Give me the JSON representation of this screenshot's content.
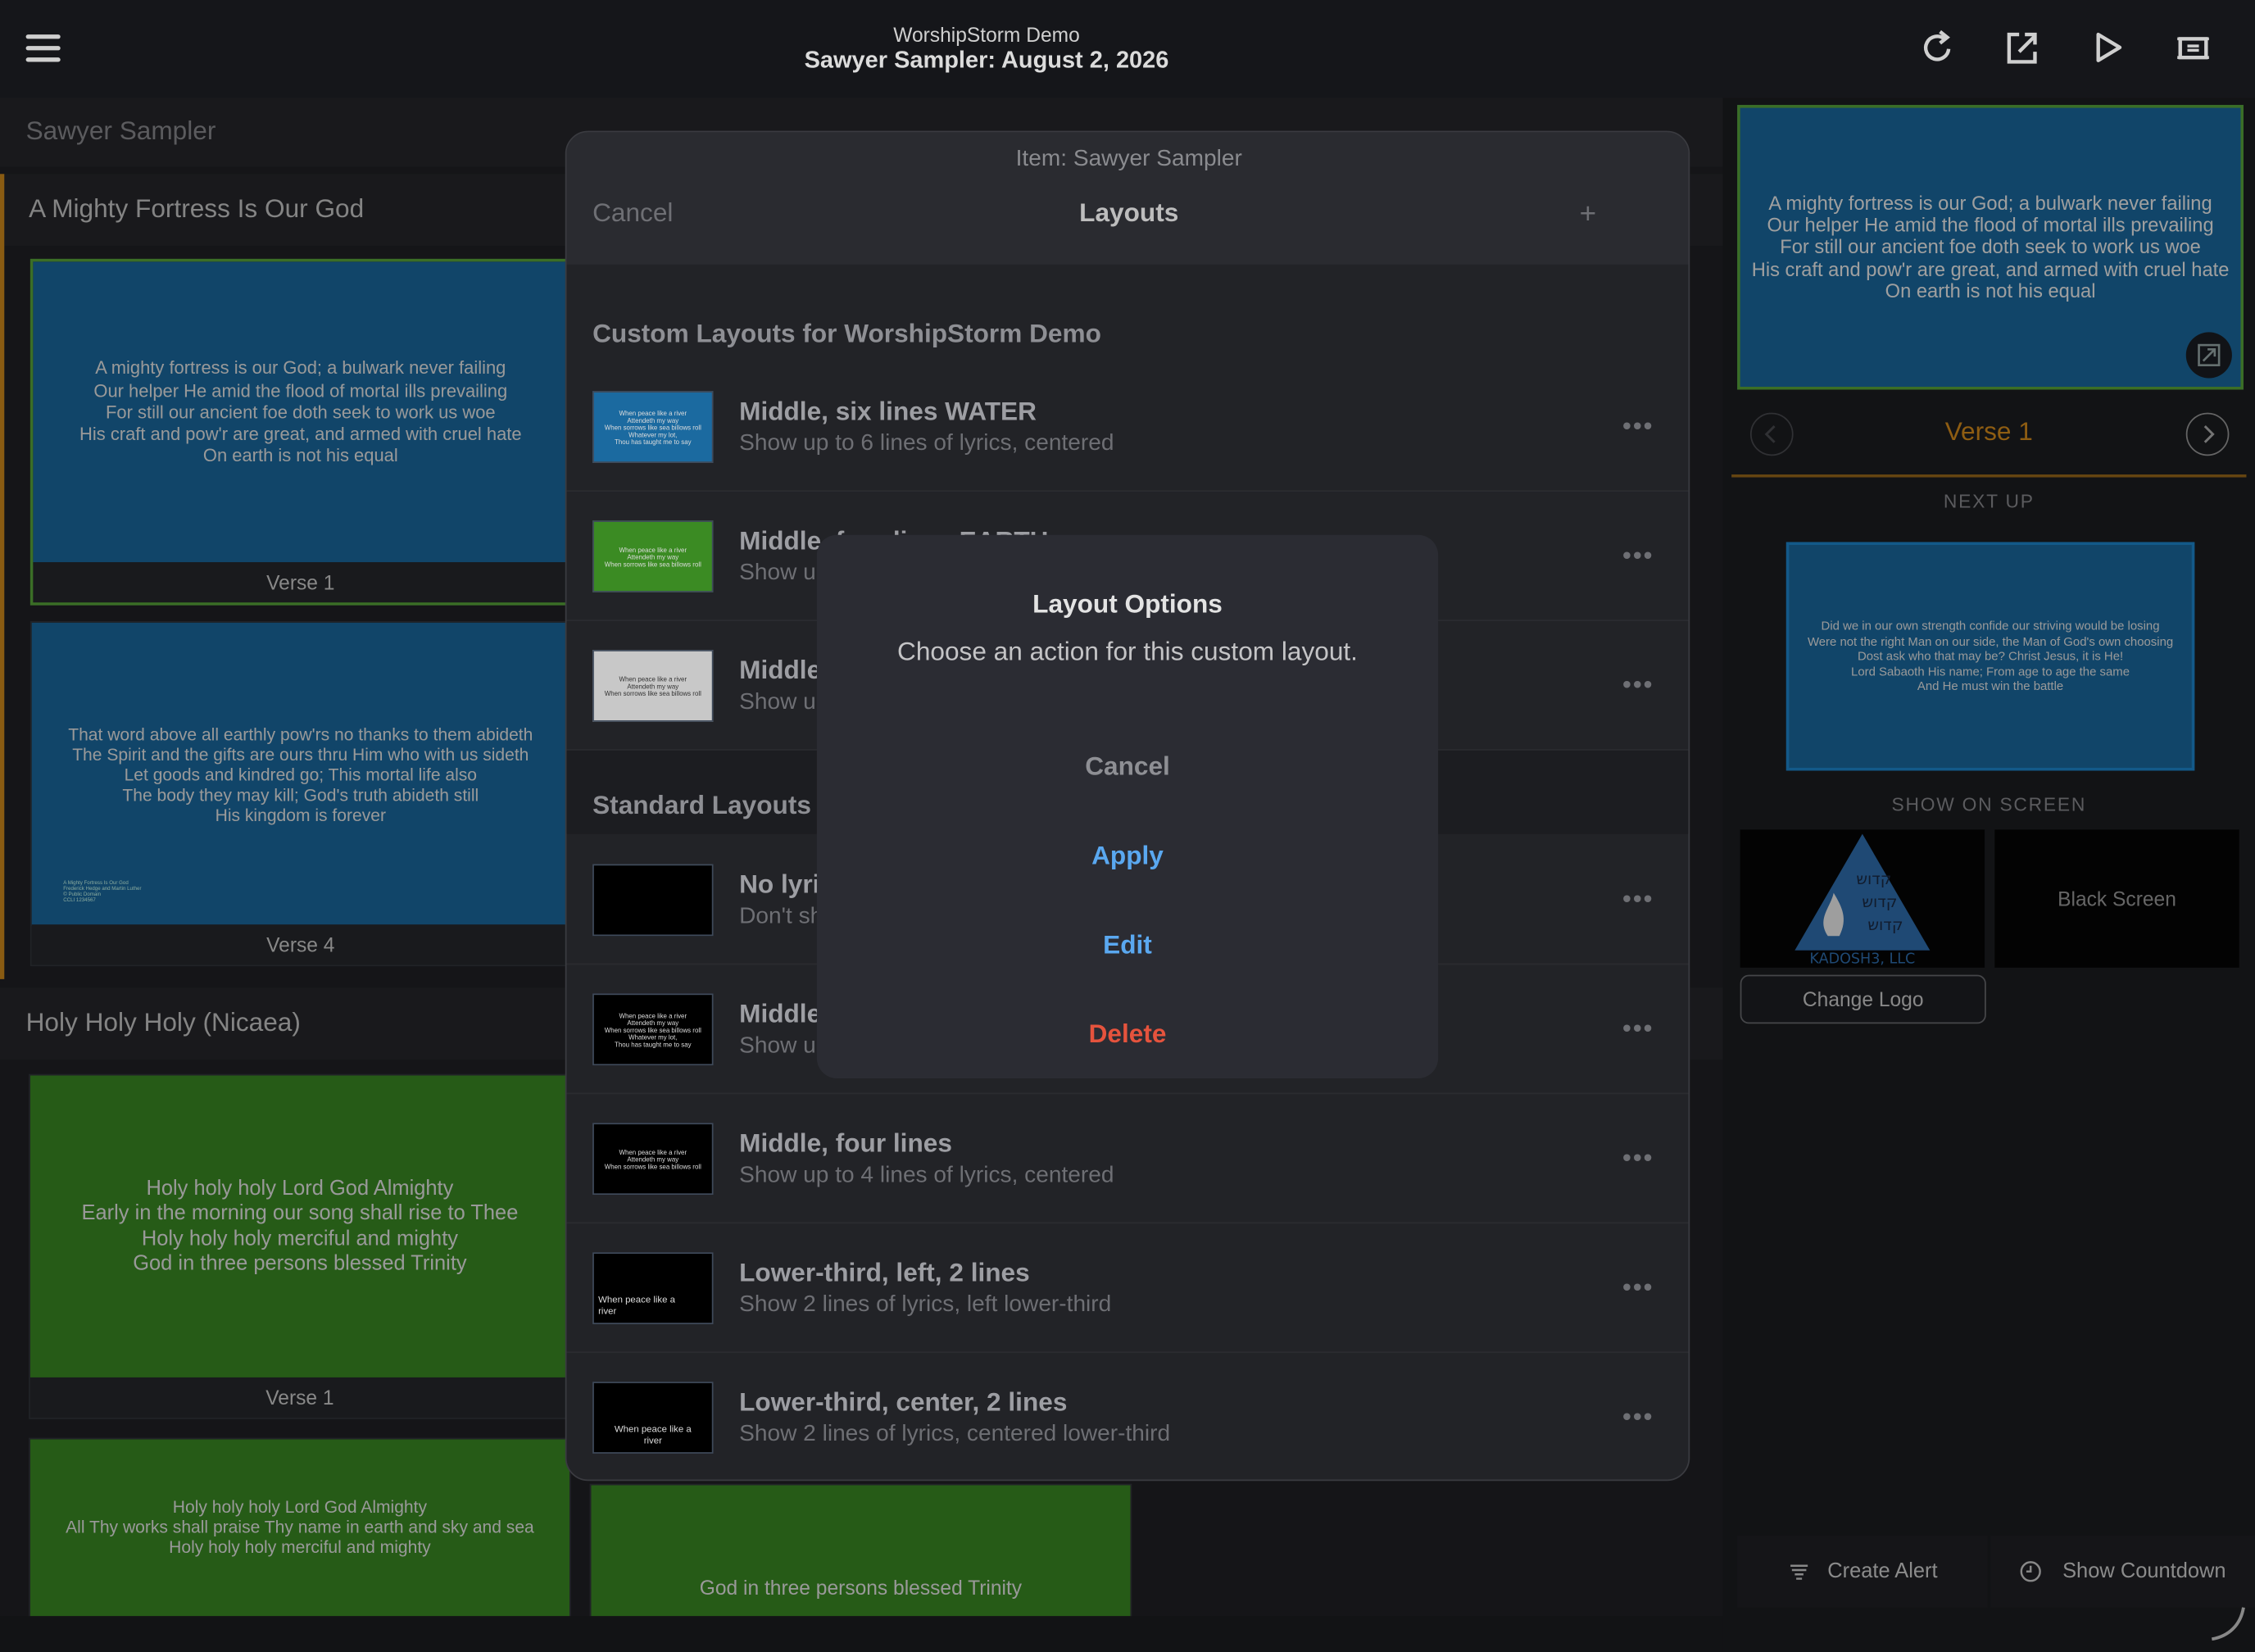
{
  "topbar": {
    "app_title": "WorshipStorm Demo",
    "service_title": "Sawyer Sampler: August 2, 2026",
    "icons": [
      "menu-icon",
      "refresh-icon",
      "export-icon",
      "play-icon",
      "screen-icon"
    ]
  },
  "list": {
    "header": "Sawyer Sampler",
    "songs": [
      {
        "title": "A Mighty Fortress Is Our God",
        "slides": [
          {
            "caption": "Verse 1",
            "lyrics": [
              "A mighty fortress is our God; a bulwark never failing",
              "Our helper He amid the flood of mortal ills prevailing",
              "For still our ancient foe doth seek to work us woe",
              "His craft and pow'r are great, and armed with cruel hate",
              "On earth is not his equal"
            ]
          },
          {
            "caption": "Verse 4",
            "lyrics": [
              "That word above all earthly pow'rs no thanks to them abideth",
              "The Spirit and the gifts are ours thru Him who with us sideth",
              "Let goods and kindred go; This mortal life also",
              "The body they may kill; God's truth abideth still",
              "His kingdom is forever"
            ],
            "credit": [
              "A Mighty Fortress Is Our God",
              "Frederick Hedge and Martin Luther",
              "© Public Domain",
              "CCLI 1234567"
            ]
          }
        ]
      },
      {
        "title": "Holy Holy Holy (Nicaea)",
        "slides": [
          {
            "caption": "Verse 1",
            "lyrics": [
              "Holy holy holy Lord God Almighty",
              "Early in the morning our song shall rise to Thee",
              "Holy holy holy merciful and mighty",
              "God in three persons blessed Trinity"
            ]
          },
          {
            "caption": "",
            "lyrics": [
              "Holy holy holy Lord God Almighty",
              "All Thy works shall praise Thy name in earth and sky and sea",
              "Holy holy holy merciful and mighty"
            ]
          },
          {
            "caption": "",
            "lyrics": [
              "God in three persons blessed Trinity"
            ]
          }
        ]
      }
    ]
  },
  "right": {
    "live_lyrics": [
      "A mighty fortress is our God; a bulwark never failing",
      "Our helper He amid the flood of mortal ills prevailing",
      "For still our ancient foe doth seek to work us woe",
      "His craft and pow'r are great, and armed with cruel hate",
      "On earth is not his equal"
    ],
    "verse_label": "Verse 1",
    "next_up_label": "NEXT UP",
    "next_up_lyrics": [
      "Did we in our own strength confide our striving would be losing",
      "Were not the right Man on our side, the Man of God's own choosing",
      "Dost ask who that may be? Christ Jesus, it is He!",
      "Lord Sabaoth His name; From age to age the same",
      "And He must win the battle"
    ],
    "show_on_screen_label": "SHOW ON SCREEN",
    "logo_text": "KADOSH3, LLC",
    "logo_hebrew": [
      "קדוש",
      "קדוש",
      "קדוש"
    ],
    "black_screen": "Black Screen",
    "change_logo": "Change Logo",
    "create_alert": "Create Alert",
    "show_countdown": "Show Countdown"
  },
  "sheet": {
    "item_label": "Item: Sawyer Sampler",
    "cancel": "Cancel",
    "title": "Layouts",
    "add": "+",
    "custom_group": "Custom Layouts for WorshipStorm Demo",
    "standard_group": "Standard Layouts",
    "more": "•••",
    "custom_rows": [
      {
        "name": "Middle, six lines WATER",
        "desc": "Show up to 6 lines of lyrics, centered",
        "thumb_color": "#1b6aa0",
        "thumb_text": [
          "When peace like a river",
          "Attendeth my way",
          "When sorrows like sea billows roll",
          "Whatever my lot,",
          "Thou has taught me to say"
        ]
      },
      {
        "name": "Middle, four lines EARTH",
        "desc": "Show up to 4 lines of lyrics, centered",
        "thumb_color": "#3b8b23",
        "thumb_text": [
          "When peace like a river",
          "Attendeth my way",
          "When sorrows like sea billows roll"
        ]
      },
      {
        "name": "Middle, four lines",
        "desc": "Show up to 4 lines of lyrics, centered",
        "thumb_color": "#c8c8c8",
        "thumb_text": [
          "When peace like a river",
          "Attendeth my way",
          "When sorrows like sea billows roll"
        ]
      }
    ],
    "standard_rows": [
      {
        "name": "No lyrics",
        "desc": "Don't show lyrics",
        "thumb_color": "#000000",
        "thumb_text": []
      },
      {
        "name": "Middle, six lines",
        "desc": "Show up to 6 lines of lyrics, centered",
        "thumb_color": "#000000",
        "thumb_text": [
          "When peace like a river",
          "Attendeth my way",
          "When sorrows like sea billows roll",
          "Whatever my lot,",
          "Thou has taught me to say"
        ]
      },
      {
        "name": "Middle, four lines",
        "desc": "Show up to 4 lines of lyrics, centered",
        "thumb_color": "#000000",
        "thumb_text": [
          "When peace like a river",
          "Attendeth my way",
          "When sorrows like sea billows roll"
        ]
      },
      {
        "name": "Lower-third, left, 2 lines",
        "desc": "Show 2 lines of lyrics, left lower-third",
        "thumb_color": "#000000",
        "thumb_text": [
          "When peace like a",
          "river"
        ]
      },
      {
        "name": "Lower-third, center, 2 lines",
        "desc": "Show 2 lines of lyrics, centered lower-third",
        "thumb_color": "#000000",
        "thumb_text": [
          "When peace like a",
          "river"
        ]
      }
    ]
  },
  "alert": {
    "title": "Layout Options",
    "message": "Choose an action for this custom layout.",
    "cancel": "Cancel",
    "apply": "Apply",
    "edit": "Edit",
    "delete": "Delete",
    "apply_color": "#5aa8f0",
    "delete_color": "#e5533d"
  }
}
